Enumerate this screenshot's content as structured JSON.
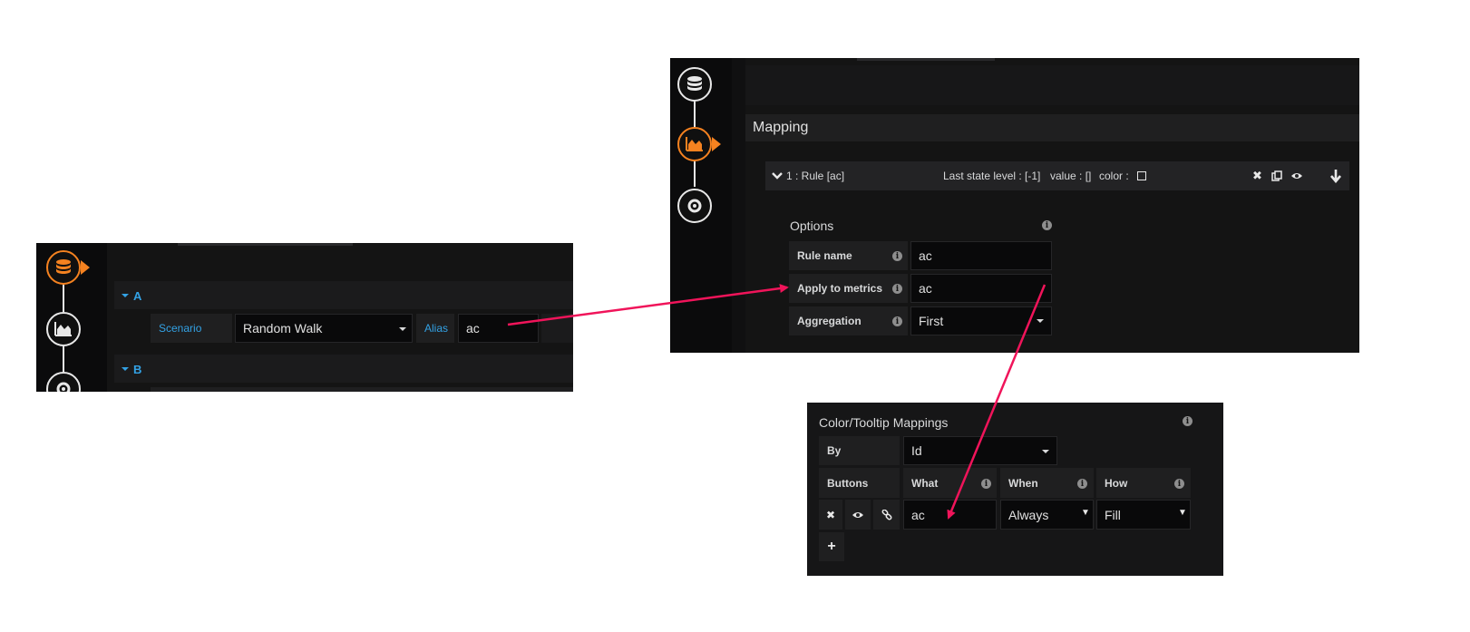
{
  "left_panel": {
    "query_a": {
      "letter": "A"
    },
    "scenario_label": "Scenario",
    "scenario_value": "Random Walk",
    "alias_label": "Alias",
    "alias_value": "ac",
    "query_b": {
      "letter": "B"
    }
  },
  "right_panel": {
    "section_title": "Mapping",
    "rule": {
      "title": "1 : Rule [ac]",
      "last_state": "Last state level : [-1]",
      "value": "value : []",
      "color": "color :"
    },
    "options": {
      "title": "Options",
      "rule_name_label": "Rule name",
      "rule_name_value": "ac",
      "apply_metrics_label": "Apply to metrics",
      "apply_metrics_value": "ac",
      "aggregation_label": "Aggregation",
      "aggregation_value": "First"
    }
  },
  "bottom_panel": {
    "title": "Color/Tooltip Mappings",
    "by_label": "By",
    "by_value": "Id",
    "headers": {
      "buttons": "Buttons",
      "what": "What",
      "when": "When",
      "how": "How"
    },
    "row": {
      "what": "ac",
      "when": "Always",
      "how": "Fill"
    },
    "add_symbol": "+"
  },
  "icons": [
    "database-icon",
    "chart-icon",
    "gear-icon",
    "info-icon",
    "chevron-down-icon",
    "close-icon",
    "copy-icon",
    "eye-icon",
    "arrow-down-icon",
    "link-icon",
    "plus-icon"
  ],
  "colors": {
    "accent": "#f58220",
    "arrow": "#f0145a",
    "blue_label": "#33a2e5",
    "panel_bg": "#141414"
  }
}
